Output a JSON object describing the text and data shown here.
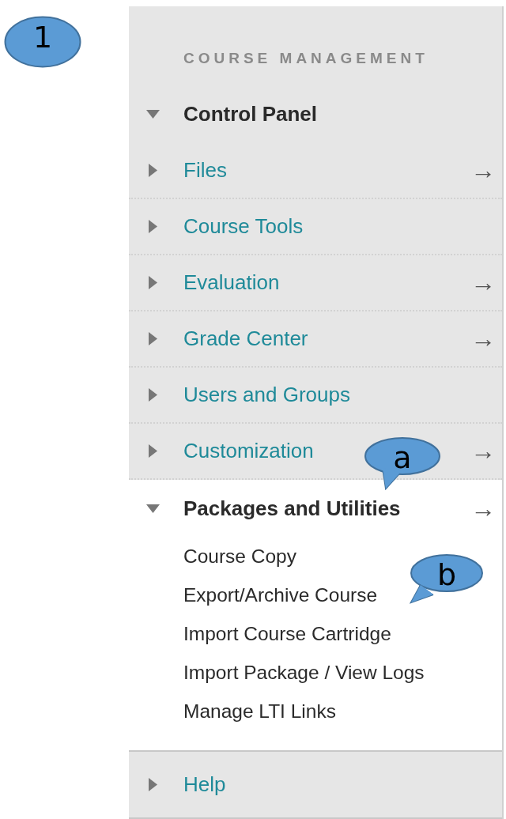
{
  "heading": "COURSE MANAGEMENT",
  "menu": [
    {
      "kind": "section",
      "label": "Control Panel",
      "expanded": true,
      "children": [
        {
          "kind": "section",
          "label": "Files",
          "expanded": false,
          "arrow": "→"
        },
        {
          "kind": "section",
          "label": "Course Tools",
          "expanded": false
        },
        {
          "kind": "section",
          "label": "Evaluation",
          "expanded": false,
          "arrow": "→"
        },
        {
          "kind": "section",
          "label": "Grade Center",
          "expanded": false,
          "arrow": "→"
        },
        {
          "kind": "section",
          "label": "Users and Groups",
          "expanded": false
        },
        {
          "kind": "section",
          "label": "Customization",
          "expanded": false,
          "arrow": "→"
        },
        {
          "kind": "section",
          "label": "Packages and Utilities",
          "expanded": true,
          "arrow": "→",
          "children": [
            {
              "kind": "link",
              "label": "Course Copy"
            },
            {
              "kind": "link",
              "label": "Export/Archive Course"
            },
            {
              "kind": "link",
              "label": "Import Course Cartridge"
            },
            {
              "kind": "link",
              "label": "Import Package / View Logs"
            },
            {
              "kind": "link",
              "label": "Manage LTI Links"
            }
          ]
        }
      ]
    },
    {
      "kind": "section",
      "label": "Help",
      "expanded": false
    }
  ],
  "callouts": [
    {
      "kind": "oval",
      "label": "1"
    },
    {
      "kind": "bubble",
      "label": "a"
    },
    {
      "kind": "bubble",
      "label": "b"
    }
  ]
}
